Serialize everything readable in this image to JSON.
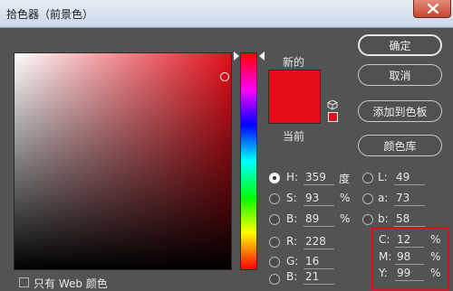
{
  "window": {
    "title": "拾色器（前景色）"
  },
  "picker": {
    "new_label": "新的",
    "current_label": "当前",
    "new_color": "#e40e1a",
    "current_color": "#e40e1a"
  },
  "buttons": {
    "ok": "确定",
    "cancel": "取消",
    "add_to_swatches": "添加到色板",
    "color_libraries": "颜色库"
  },
  "hsb": {
    "h": {
      "label": "H:",
      "value": "359",
      "unit": "度"
    },
    "s": {
      "label": "S:",
      "value": "93",
      "unit": "%"
    },
    "b": {
      "label": "B:",
      "value": "89",
      "unit": "%"
    }
  },
  "rgb": {
    "r": {
      "label": "R:",
      "value": "228"
    },
    "g": {
      "label": "G:",
      "value": "16"
    },
    "b": {
      "label": "B:",
      "value": "21"
    }
  },
  "lab": {
    "l": {
      "label": "L:",
      "value": "49"
    },
    "a": {
      "label": "a:",
      "value": "73"
    },
    "b": {
      "label": "b:",
      "value": "58"
    }
  },
  "cmyk": {
    "c": {
      "label": "C:",
      "value": "12",
      "unit": "%"
    },
    "m": {
      "label": "M:",
      "value": "98",
      "unit": "%"
    },
    "y": {
      "label": "Y:",
      "value": "99",
      "unit": "%"
    }
  },
  "footer": {
    "only_web_colors": "只有 Web 颜色"
  },
  "icons": {
    "close": "close-icon",
    "gamut_warning": "cube-icon"
  },
  "colors": {
    "highlight_box": "#d8121a",
    "dialog_bg": "#535353"
  }
}
